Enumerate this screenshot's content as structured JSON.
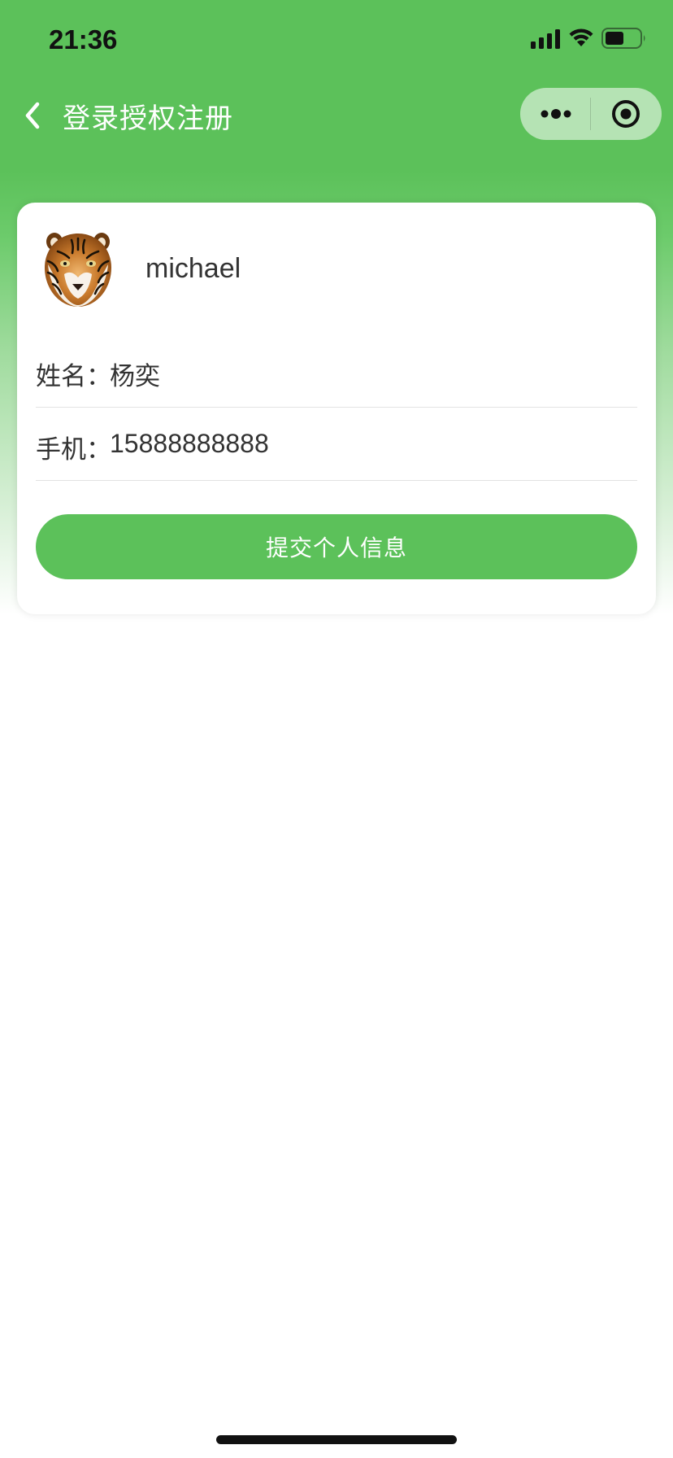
{
  "status_bar": {
    "time": "21:36",
    "icons": [
      "signal-icon",
      "wifi-icon",
      "battery-icon"
    ]
  },
  "nav": {
    "title": "登录授权注册",
    "back_icon": "chevron-left-icon",
    "capsule_icons": [
      "more-dots-icon",
      "close-circle-icon"
    ]
  },
  "profile": {
    "avatar": "tiger-avatar",
    "username": "michael"
  },
  "form": {
    "name_label": "姓名：",
    "name_value": "杨奕",
    "phone_label": "手机：",
    "phone_value": "15888888888"
  },
  "submit_label": "提交个人信息",
  "colors": {
    "brand_green": "#5cc15a",
    "text": "#333333",
    "divider": "#e2e2e2"
  }
}
